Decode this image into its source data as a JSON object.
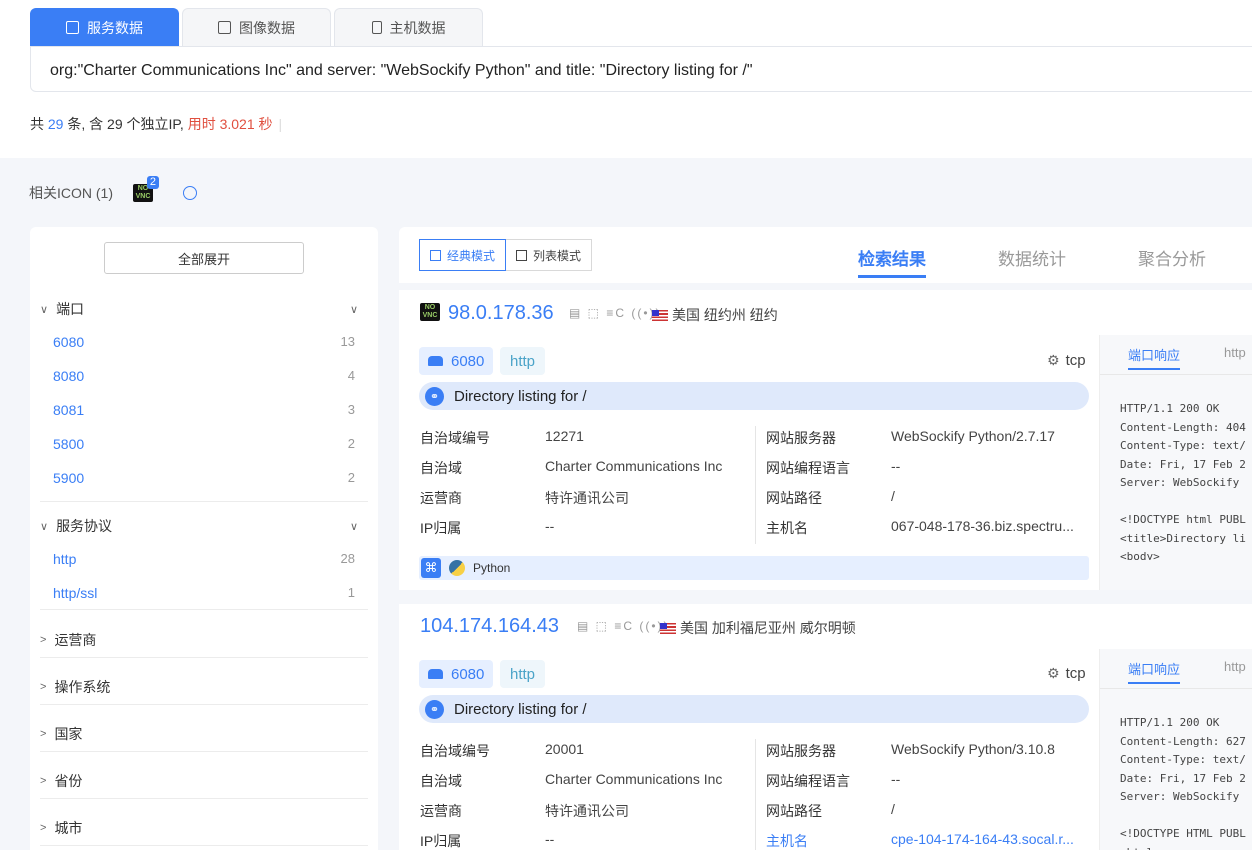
{
  "tabs": [
    {
      "label": "服务数据",
      "icon": "table-icon"
    },
    {
      "label": "图像数据",
      "icon": "image-icon"
    },
    {
      "label": "主机数据",
      "icon": "server-icon"
    }
  ],
  "query": "org:\"Charter Communications Inc\" and server: \"WebSockify Python\" and title: \"Directory listing for /\"",
  "summary": {
    "p1": "共 ",
    "count": "29",
    "p2": " 条, 含 29 个独立IP, ",
    "time": "用时 3.021 秒"
  },
  "related_icon": {
    "label": "相关ICON (1)",
    "badge": "2",
    "novnc_text": "NO VNC"
  },
  "sidebar": {
    "expand_all": "全部展开",
    "ports_title": "端口",
    "ports": [
      {
        "k": "6080",
        "v": "13"
      },
      {
        "k": "8080",
        "v": "4"
      },
      {
        "k": "8081",
        "v": "3"
      },
      {
        "k": "5800",
        "v": "2"
      },
      {
        "k": "5900",
        "v": "2"
      }
    ],
    "protocols_title": "服务协议",
    "protocols": [
      {
        "k": "http",
        "v": "28"
      },
      {
        "k": "http/ssl",
        "v": "1"
      }
    ],
    "collapsed": [
      "运营商",
      "操作系统",
      "国家",
      "省份",
      "城市"
    ]
  },
  "modes": {
    "classic": "经典模式",
    "list": "列表模式"
  },
  "result_tabs": [
    "检索结果",
    "数据统计",
    "聚合分析"
  ],
  "fields": {
    "asn": "自治域编号",
    "as": "自治域",
    "isp": "运营商",
    "ip_owner": "IP归属",
    "server": "网站服务器",
    "lang": "网站编程语言",
    "path": "网站路径",
    "host": "主机名"
  },
  "results": [
    {
      "ip": "98.0.178.36",
      "geo": "美国 纽约州 纽约",
      "port": "6080",
      "proto": "http",
      "transport": "tcp",
      "title": "Directory listing for /",
      "asn": "12271",
      "as": "Charter Communications Inc",
      "isp": "特许通讯公司",
      "ip_owner": "--",
      "server": "WebSockify Python/2.7.17",
      "lang": "--",
      "path": "/",
      "host": "067-048-178-36.biz.spectru...",
      "tech": "Python",
      "resp_tab1": "端口响应",
      "resp_tab2": "http",
      "response": "HTTP/1.1 200 OK\nContent-Length: 404\nContent-Type: text/\nDate: Fri, 17 Feb 2\nServer: WebSockify\n\n<!DOCTYPE html PUBL\n<title>Directory li\n<body>"
    },
    {
      "ip": "104.174.164.43",
      "geo": "美国 加利福尼亚州 威尔明顿",
      "port": "6080",
      "proto": "http",
      "transport": "tcp",
      "title": "Directory listing for /",
      "asn": "20001",
      "as": "Charter Communications Inc",
      "isp": "特许通讯公司",
      "ip_owner": "--",
      "server": "WebSockify Python/3.10.8",
      "lang": "--",
      "path": "/",
      "host": "cpe-104-174-164-43.socal.r...",
      "resp_tab1": "端口响应",
      "resp_tab2": "http",
      "response": "HTTP/1.1 200 OK\nContent-Length: 627\nContent-Type: text/\nDate: Fri, 17 Feb 2\nServer: WebSockify\n\n<!DOCTYPE HTML PUBL\n<html>"
    }
  ]
}
